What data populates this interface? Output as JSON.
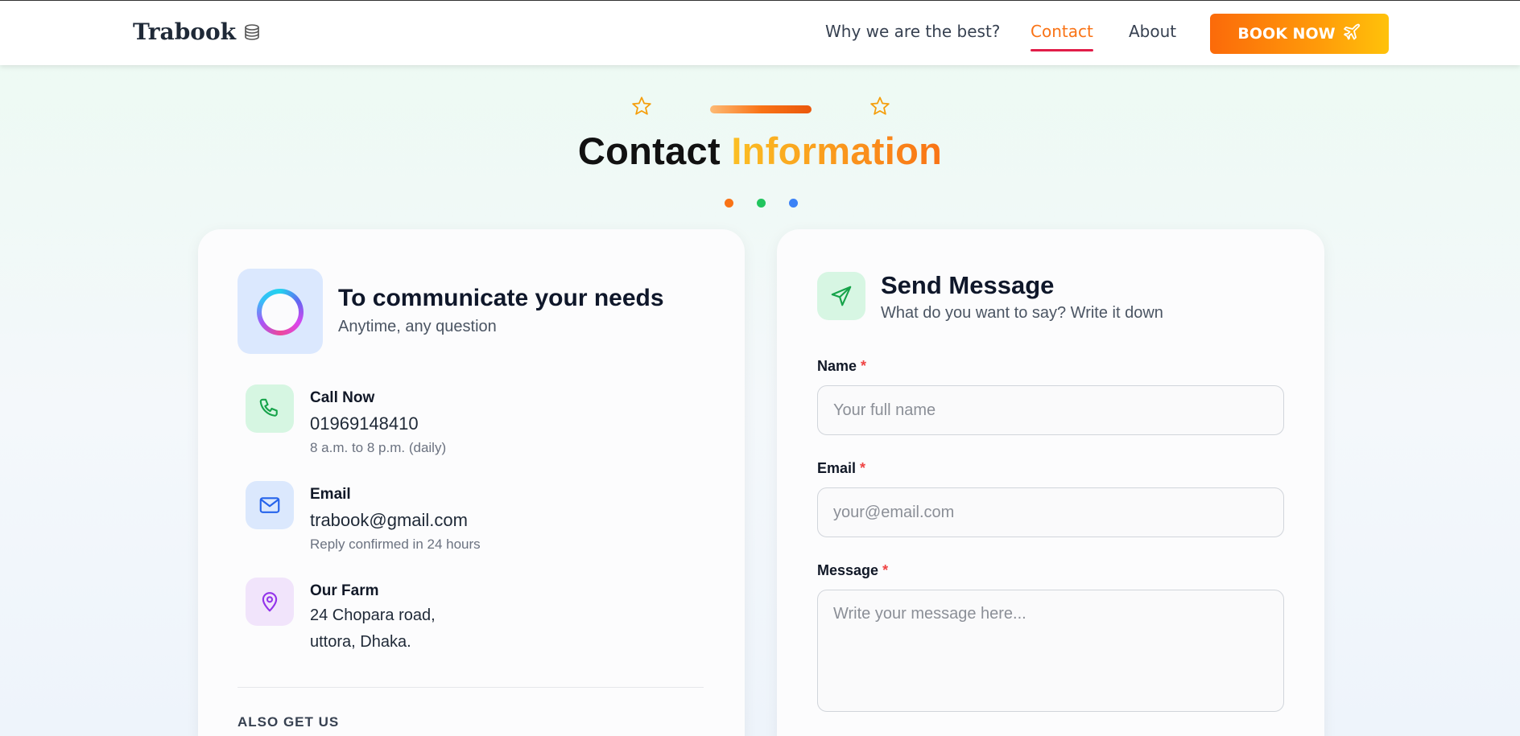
{
  "header": {
    "logo_text": "Trabook",
    "nav": [
      {
        "label": "Why we are the best?"
      },
      {
        "label": "Contact",
        "active": true
      },
      {
        "label": "About"
      }
    ],
    "book_button_label": "BOOK NOW",
    "book_button_icon": "airplane-icon"
  },
  "hero": {
    "title_part1": "Contact",
    "title_part2": "Information",
    "dot_colors": [
      "#f97316",
      "#22c55e",
      "#3b82f6"
    ]
  },
  "left_card": {
    "title": "To communicate your needs",
    "subtitle": "Anytime, any question",
    "items": [
      {
        "icon": "phone-icon",
        "label": "Call Now",
        "value": "01969148410",
        "note": "8 a.m. to 8 p.m. (daily)"
      },
      {
        "icon": "mail-icon",
        "label": "Email",
        "value": "trabook@gmail.com",
        "note": "Reply confirmed in 24 hours"
      },
      {
        "icon": "map-pin-icon",
        "label": "Our Farm",
        "lines": [
          "24 Chopara road,",
          "uttora, Dhaka."
        ]
      }
    ],
    "also_heading": "ALSO GET US"
  },
  "right_card": {
    "title": "Send Message",
    "subtitle": "What do you want to say? Write it down",
    "fields": [
      {
        "label": "Name",
        "required_mark": "*",
        "placeholder": "Your full name"
      },
      {
        "label": "Email",
        "required_mark": "*",
        "placeholder": "your@email.com"
      },
      {
        "label": "Message",
        "required_mark": "*",
        "placeholder": "Write your message here..."
      }
    ]
  },
  "colors": {
    "accent_orange": "#f97316",
    "nav_underline": "#e11d48",
    "required": "#ef4444"
  }
}
